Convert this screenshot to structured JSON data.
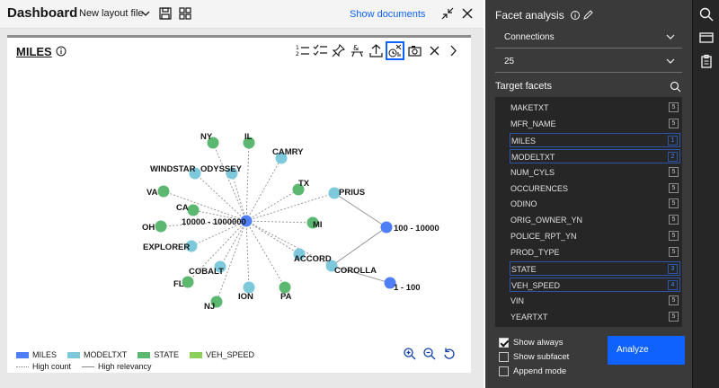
{
  "header": {
    "app_title": "Dashboard",
    "layout_select": "New layout file",
    "show_documents": "Show documents"
  },
  "viz": {
    "title": "MILES",
    "legend": [
      {
        "label": "MILES",
        "color": "#4f7ff7"
      },
      {
        "label": "MODELTXT",
        "color": "#7ec8dc"
      },
      {
        "label": "STATE",
        "color": "#5cb870"
      },
      {
        "label": "VEH_SPEED",
        "color": "#8cd05a"
      }
    ],
    "edge_legend": [
      {
        "label": "High count",
        "style": "dotted"
      },
      {
        "label": "High relevancy",
        "style": "solid"
      }
    ],
    "graph": {
      "nodes": [
        {
          "id": "hub",
          "label": "10000 - 1000000",
          "type": "MILES"
        },
        {
          "id": "n100",
          "label": "100 - 10000",
          "type": "MILES"
        },
        {
          "id": "n1",
          "label": "1 - 100",
          "type": "MILES"
        },
        {
          "id": "ny",
          "label": "NY",
          "type": "STATE"
        },
        {
          "id": "il",
          "label": "IL",
          "type": "STATE"
        },
        {
          "id": "camry",
          "label": "CAMRY",
          "type": "MODELTXT"
        },
        {
          "id": "windstar",
          "label": "WINDSTAR",
          "type": "MODELTXT"
        },
        {
          "id": "odyssey",
          "label": "ODYSSEY",
          "type": "MODELTXT"
        },
        {
          "id": "tx",
          "label": "TX",
          "type": "STATE"
        },
        {
          "id": "prius",
          "label": "PRIUS",
          "type": "MODELTXT"
        },
        {
          "id": "va",
          "label": "VA",
          "type": "STATE"
        },
        {
          "id": "ca",
          "label": "CA",
          "type": "STATE"
        },
        {
          "id": "oh",
          "label": "OH",
          "type": "STATE"
        },
        {
          "id": "mi",
          "label": "MI",
          "type": "STATE"
        },
        {
          "id": "explorer",
          "label": "EXPLORER",
          "type": "MODELTXT"
        },
        {
          "id": "accord",
          "label": "ACCORD",
          "type": "MODELTXT"
        },
        {
          "id": "corolla",
          "label": "COROLLA",
          "type": "MODELTXT"
        },
        {
          "id": "cobalt",
          "label": "COBALT",
          "type": "MODELTXT"
        },
        {
          "id": "fl",
          "label": "FL",
          "type": "STATE"
        },
        {
          "id": "nj",
          "label": "NJ",
          "type": "STATE"
        },
        {
          "id": "ion",
          "label": "ION",
          "type": "MODELTXT"
        },
        {
          "id": "pa",
          "label": "PA",
          "type": "STATE"
        }
      ],
      "edges": [
        {
          "from": "hub",
          "to": "ny",
          "style": "dotted"
        },
        {
          "from": "hub",
          "to": "il",
          "style": "dotted"
        },
        {
          "from": "hub",
          "to": "camry",
          "style": "dotted"
        },
        {
          "from": "hub",
          "to": "windstar",
          "style": "dotted"
        },
        {
          "from": "hub",
          "to": "odyssey",
          "style": "dotted"
        },
        {
          "from": "hub",
          "to": "tx",
          "style": "dotted"
        },
        {
          "from": "hub",
          "to": "prius",
          "style": "dotted"
        },
        {
          "from": "hub",
          "to": "va",
          "style": "dotted"
        },
        {
          "from": "hub",
          "to": "ca",
          "style": "dotted"
        },
        {
          "from": "hub",
          "to": "oh",
          "style": "dotted"
        },
        {
          "from": "hub",
          "to": "mi",
          "style": "dotted"
        },
        {
          "from": "hub",
          "to": "explorer",
          "style": "dotted"
        },
        {
          "from": "hub",
          "to": "accord",
          "style": "dotted"
        },
        {
          "from": "hub",
          "to": "corolla",
          "style": "dotted"
        },
        {
          "from": "hub",
          "to": "cobalt",
          "style": "dotted"
        },
        {
          "from": "hub",
          "to": "fl",
          "style": "dotted"
        },
        {
          "from": "hub",
          "to": "nj",
          "style": "dotted"
        },
        {
          "from": "hub",
          "to": "ion",
          "style": "dotted"
        },
        {
          "from": "hub",
          "to": "pa",
          "style": "dotted"
        },
        {
          "from": "n100",
          "to": "prius",
          "style": "solid"
        },
        {
          "from": "n100",
          "to": "corolla",
          "style": "solid"
        },
        {
          "from": "n1",
          "to": "corolla",
          "style": "solid"
        }
      ]
    }
  },
  "facet_panel": {
    "title": "Facet analysis",
    "connections_select": "Connections",
    "count_select": "25",
    "target_label": "Target facets",
    "facets": [
      {
        "name": "MAKETXT",
        "badge": "5",
        "selected": false
      },
      {
        "name": "MFR_NAME",
        "badge": "5",
        "selected": false
      },
      {
        "name": "MILES",
        "badge": "1",
        "selected": true
      },
      {
        "name": "MODELTXT",
        "badge": "2",
        "selected": true
      },
      {
        "name": "NUM_CYLS",
        "badge": "5",
        "selected": false
      },
      {
        "name": "OCCURENCES",
        "badge": "5",
        "selected": false
      },
      {
        "name": "ODINO",
        "badge": "5",
        "selected": false
      },
      {
        "name": "ORIG_OWNER_YN",
        "badge": "5",
        "selected": false
      },
      {
        "name": "POLICE_RPT_YN",
        "badge": "5",
        "selected": false
      },
      {
        "name": "PROD_TYPE",
        "badge": "5",
        "selected": false
      },
      {
        "name": "STATE",
        "badge": "3",
        "selected": true
      },
      {
        "name": "VEH_SPEED",
        "badge": "4",
        "selected": true
      },
      {
        "name": "VIN",
        "badge": "5",
        "selected": false
      },
      {
        "name": "YEARTXT",
        "badge": "5",
        "selected": false
      }
    ],
    "options": [
      {
        "label": "Show always",
        "checked": true
      },
      {
        "label": "Show subfacet",
        "checked": false
      },
      {
        "label": "Append mode",
        "checked": false
      }
    ],
    "analyze_label": "Analyze"
  }
}
